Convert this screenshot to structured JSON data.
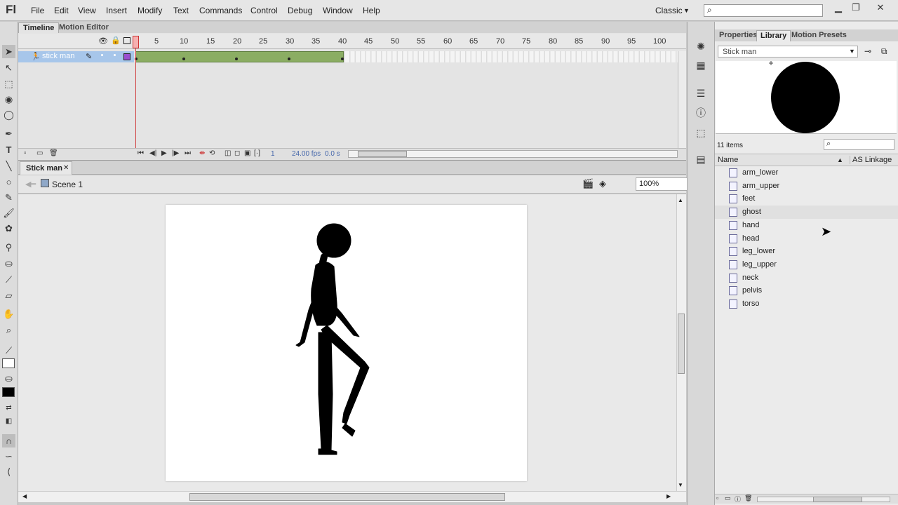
{
  "app": {
    "logo": "Fl",
    "menu": [
      "File",
      "Edit",
      "View",
      "Insert",
      "Modify",
      "Text",
      "Commands",
      "Control",
      "Debug",
      "Window",
      "Help"
    ],
    "workspace": "Classic",
    "window_buttons": [
      "minimize",
      "restore",
      "close"
    ]
  },
  "timeline": {
    "tabs": [
      "Timeline",
      "Motion Editor"
    ],
    "frame_numbers": [
      "1",
      "5",
      "10",
      "15",
      "20",
      "25",
      "30",
      "35",
      "40",
      "45",
      "50",
      "55",
      "60",
      "65",
      "70",
      "75",
      "80",
      "85",
      "90",
      "95",
      "100"
    ],
    "layer": {
      "name": "stick man"
    },
    "current_frame": "1",
    "fps": "24.00 fps",
    "time": "0.0 s"
  },
  "document": {
    "tab_label": "Stick man",
    "scene_label": "Scene 1",
    "zoom": "100%"
  },
  "library": {
    "tabs": [
      "Properties",
      "Library",
      "Motion Presets"
    ],
    "selected_document": "Stick man",
    "item_count": "11 items",
    "columns": {
      "name": "Name",
      "linkage": "AS Linkage"
    },
    "items": [
      "arm_lower",
      "arm_upper",
      "feet",
      "ghost",
      "hand",
      "head",
      "leg_lower",
      "leg_upper",
      "neck",
      "pelvis",
      "torso"
    ],
    "highlighted_item": "ghost"
  },
  "colors": {
    "layer_highlight": "#a7c6ea",
    "tween_span": "#8bad63",
    "playhead": "#d04040",
    "figure": "#000000"
  }
}
